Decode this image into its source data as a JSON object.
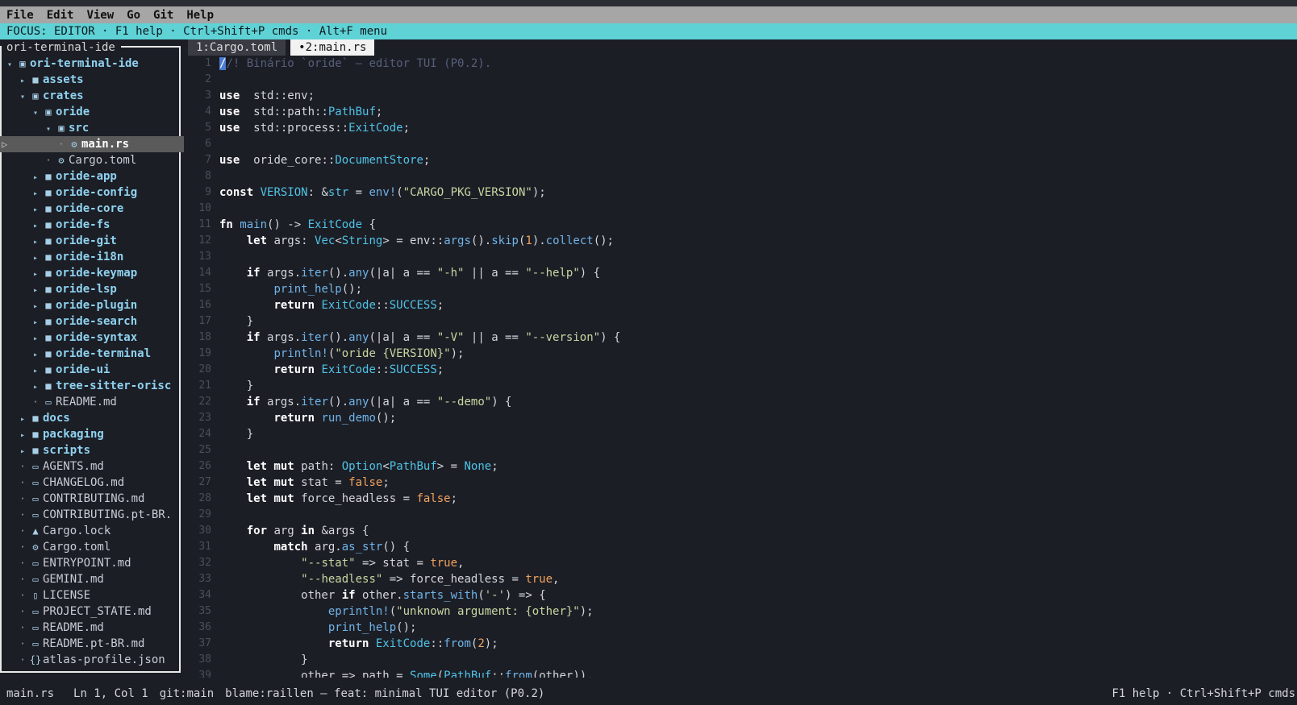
{
  "menu": [
    "File",
    "Edit",
    "View",
    "Go",
    "Git",
    "Help"
  ],
  "focus_bar": "FOCUS: EDITOR  ·  F1 help · Ctrl+Shift+P cmds · Alt+F menu",
  "sidebar": {
    "title": "ori-terminal-ide",
    "items": [
      {
        "label": "ori-terminal-ide",
        "kind": "dir",
        "depth": 1,
        "expanded": true,
        "icon": "folder-open-icon"
      },
      {
        "label": "assets",
        "kind": "dir",
        "depth": 2,
        "expanded": false,
        "icon": "folder-icon"
      },
      {
        "label": "crates",
        "kind": "dir",
        "depth": 2,
        "expanded": true,
        "icon": "folder-open-icon"
      },
      {
        "label": "oride",
        "kind": "dir",
        "depth": 3,
        "expanded": true,
        "icon": "folder-open-icon"
      },
      {
        "label": "src",
        "kind": "dir",
        "depth": 4,
        "expanded": true,
        "icon": "folder-open-icon"
      },
      {
        "label": "main.rs",
        "kind": "file",
        "depth": 5,
        "selected": true,
        "icon": "rust-icon"
      },
      {
        "label": "Cargo.toml",
        "kind": "file",
        "depth": 4,
        "icon": "gear-icon"
      },
      {
        "label": "oride-app",
        "kind": "dir",
        "depth": 3,
        "expanded": false,
        "icon": "folder-icon"
      },
      {
        "label": "oride-config",
        "kind": "dir",
        "depth": 3,
        "expanded": false,
        "icon": "folder-icon"
      },
      {
        "label": "oride-core",
        "kind": "dir",
        "depth": 3,
        "expanded": false,
        "icon": "folder-icon"
      },
      {
        "label": "oride-fs",
        "kind": "dir",
        "depth": 3,
        "expanded": false,
        "icon": "folder-icon"
      },
      {
        "label": "oride-git",
        "kind": "dir",
        "depth": 3,
        "expanded": false,
        "icon": "folder-icon"
      },
      {
        "label": "oride-i18n",
        "kind": "dir",
        "depth": 3,
        "expanded": false,
        "icon": "folder-icon"
      },
      {
        "label": "oride-keymap",
        "kind": "dir",
        "depth": 3,
        "expanded": false,
        "icon": "folder-icon"
      },
      {
        "label": "oride-lsp",
        "kind": "dir",
        "depth": 3,
        "expanded": false,
        "icon": "folder-icon"
      },
      {
        "label": "oride-plugin",
        "kind": "dir",
        "depth": 3,
        "expanded": false,
        "icon": "folder-icon"
      },
      {
        "label": "oride-search",
        "kind": "dir",
        "depth": 3,
        "expanded": false,
        "icon": "folder-icon"
      },
      {
        "label": "oride-syntax",
        "kind": "dir",
        "depth": 3,
        "expanded": false,
        "icon": "folder-icon"
      },
      {
        "label": "oride-terminal",
        "kind": "dir",
        "depth": 3,
        "expanded": false,
        "icon": "folder-icon"
      },
      {
        "label": "oride-ui",
        "kind": "dir",
        "depth": 3,
        "expanded": false,
        "icon": "folder-icon"
      },
      {
        "label": "tree-sitter-orisc",
        "kind": "dir",
        "depth": 3,
        "expanded": false,
        "icon": "folder-icon"
      },
      {
        "label": "README.md",
        "kind": "file",
        "depth": 3,
        "icon": "markdown-icon"
      },
      {
        "label": "docs",
        "kind": "dir",
        "depth": 2,
        "expanded": false,
        "icon": "folder-icon"
      },
      {
        "label": "packaging",
        "kind": "dir",
        "depth": 2,
        "expanded": false,
        "icon": "folder-icon"
      },
      {
        "label": "scripts",
        "kind": "dir",
        "depth": 2,
        "expanded": false,
        "icon": "folder-icon"
      },
      {
        "label": "AGENTS.md",
        "kind": "file",
        "depth": 2,
        "icon": "markdown-icon"
      },
      {
        "label": "CHANGELOG.md",
        "kind": "file",
        "depth": 2,
        "icon": "markdown-icon"
      },
      {
        "label": "CONTRIBUTING.md",
        "kind": "file",
        "depth": 2,
        "icon": "markdown-icon"
      },
      {
        "label": "CONTRIBUTING.pt-BR.",
        "kind": "file",
        "depth": 2,
        "icon": "markdown-icon"
      },
      {
        "label": "Cargo.lock",
        "kind": "file",
        "depth": 2,
        "icon": "lock-icon"
      },
      {
        "label": "Cargo.toml",
        "kind": "file",
        "depth": 2,
        "icon": "gear-icon"
      },
      {
        "label": "ENTRYPOINT.md",
        "kind": "file",
        "depth": 2,
        "icon": "markdown-icon"
      },
      {
        "label": "GEMINI.md",
        "kind": "file",
        "depth": 2,
        "icon": "markdown-icon"
      },
      {
        "label": "LICENSE",
        "kind": "file",
        "depth": 2,
        "icon": "license-icon"
      },
      {
        "label": "PROJECT_STATE.md",
        "kind": "file",
        "depth": 2,
        "icon": "markdown-icon"
      },
      {
        "label": "README.md",
        "kind": "file",
        "depth": 2,
        "icon": "markdown-icon"
      },
      {
        "label": "README.pt-BR.md",
        "kind": "file",
        "depth": 2,
        "icon": "markdown-icon"
      },
      {
        "label": "atlas-profile.json",
        "kind": "file",
        "depth": 2,
        "icon": "json-icon"
      }
    ]
  },
  "tabs": [
    {
      "label": "1:Cargo.toml",
      "active": false
    },
    {
      "label": "•2:main.rs",
      "active": true
    }
  ],
  "editor": {
    "lines": [
      [
        [
          "c",
          "//! Binário `oride` — editor TUI (P0.2)."
        ]
      ],
      [],
      [
        [
          "k",
          "use"
        ],
        [
          "",
          "  std::env;"
        ]
      ],
      [
        [
          "k",
          "use"
        ],
        [
          "",
          "  std::path::"
        ],
        [
          "t",
          "PathBuf"
        ],
        [
          "",
          ";"
        ]
      ],
      [
        [
          "k",
          "use"
        ],
        [
          "",
          "  std::process::"
        ],
        [
          "t",
          "ExitCode"
        ],
        [
          "",
          ";"
        ]
      ],
      [],
      [
        [
          "k",
          "use"
        ],
        [
          "",
          "  oride_core::"
        ],
        [
          "t",
          "DocumentStore"
        ],
        [
          "",
          ";"
        ]
      ],
      [],
      [
        [
          "k",
          "const"
        ],
        [
          "",
          " "
        ],
        [
          "t",
          "VERSION"
        ],
        [
          "",
          ": &"
        ],
        [
          "t",
          "str"
        ],
        [
          "",
          " = "
        ],
        [
          "f",
          "env!"
        ],
        [
          "",
          "("
        ],
        [
          "s",
          "\"CARGO_PKG_VERSION\""
        ],
        [
          "",
          ");"
        ]
      ],
      [],
      [
        [
          "k",
          "fn"
        ],
        [
          "",
          " "
        ],
        [
          "f",
          "main"
        ],
        [
          "",
          "() -> "
        ],
        [
          "t",
          "ExitCode"
        ],
        [
          "",
          " {"
        ]
      ],
      [
        [
          "",
          "    "
        ],
        [
          "k",
          "let"
        ],
        [
          "",
          " args: "
        ],
        [
          "t",
          "Vec"
        ],
        [
          "",
          "<"
        ],
        [
          "t",
          "String"
        ],
        [
          "",
          "> = env::"
        ],
        [
          "f",
          "args"
        ],
        [
          "",
          "()."
        ],
        [
          "f",
          "skip"
        ],
        [
          "",
          "("
        ],
        [
          "n",
          "1"
        ],
        [
          "",
          ")."
        ],
        [
          "f",
          "collect"
        ],
        [
          "",
          "();"
        ]
      ],
      [],
      [
        [
          "",
          "    "
        ],
        [
          "k",
          "if"
        ],
        [
          "",
          " args."
        ],
        [
          "f",
          "iter"
        ],
        [
          "",
          "()."
        ],
        [
          "f",
          "any"
        ],
        [
          "",
          "(|a| a == "
        ],
        [
          "s",
          "\"-h\""
        ],
        [
          "",
          " || a == "
        ],
        [
          "s",
          "\"--help\""
        ],
        [
          "",
          ") {"
        ]
      ],
      [
        [
          "",
          "        "
        ],
        [
          "f",
          "print_help"
        ],
        [
          "",
          "();"
        ]
      ],
      [
        [
          "",
          "        "
        ],
        [
          "k",
          "return"
        ],
        [
          "",
          " "
        ],
        [
          "t",
          "ExitCode"
        ],
        [
          "",
          "::"
        ],
        [
          "t",
          "SUCCESS"
        ],
        [
          "",
          ";"
        ]
      ],
      [
        [
          "",
          "    }"
        ]
      ],
      [
        [
          "",
          "    "
        ],
        [
          "k",
          "if"
        ],
        [
          "",
          " args."
        ],
        [
          "f",
          "iter"
        ],
        [
          "",
          "()."
        ],
        [
          "f",
          "any"
        ],
        [
          "",
          "(|a| a == "
        ],
        [
          "s",
          "\"-V\""
        ],
        [
          "",
          " || a == "
        ],
        [
          "s",
          "\"--version\""
        ],
        [
          "",
          ") {"
        ]
      ],
      [
        [
          "",
          "        "
        ],
        [
          "f",
          "println!"
        ],
        [
          "",
          "("
        ],
        [
          "s",
          "\"oride {VERSION}\""
        ],
        [
          "",
          ");"
        ]
      ],
      [
        [
          "",
          "        "
        ],
        [
          "k",
          "return"
        ],
        [
          "",
          " "
        ],
        [
          "t",
          "ExitCode"
        ],
        [
          "",
          "::"
        ],
        [
          "t",
          "SUCCESS"
        ],
        [
          "",
          ";"
        ]
      ],
      [
        [
          "",
          "    }"
        ]
      ],
      [
        [
          "",
          "    "
        ],
        [
          "k",
          "if"
        ],
        [
          "",
          " args."
        ],
        [
          "f",
          "iter"
        ],
        [
          "",
          "()."
        ],
        [
          "f",
          "any"
        ],
        [
          "",
          "(|a| a == "
        ],
        [
          "s",
          "\"--demo\""
        ],
        [
          "",
          ") {"
        ]
      ],
      [
        [
          "",
          "        "
        ],
        [
          "k",
          "return"
        ],
        [
          "",
          " "
        ],
        [
          "f",
          "run_demo"
        ],
        [
          "",
          "();"
        ]
      ],
      [
        [
          "",
          "    }"
        ]
      ],
      [],
      [
        [
          "",
          "    "
        ],
        [
          "k",
          "let mut"
        ],
        [
          "",
          " path: "
        ],
        [
          "t",
          "Option"
        ],
        [
          "",
          "<"
        ],
        [
          "t",
          "PathBuf"
        ],
        [
          "",
          "> = "
        ],
        [
          "t",
          "None"
        ],
        [
          "",
          ";"
        ]
      ],
      [
        [
          "",
          "    "
        ],
        [
          "k",
          "let mut"
        ],
        [
          "",
          " stat = "
        ],
        [
          "n",
          "false"
        ],
        [
          "",
          ";"
        ]
      ],
      [
        [
          "",
          "    "
        ],
        [
          "k",
          "let mut"
        ],
        [
          "",
          " force_headless = "
        ],
        [
          "n",
          "false"
        ],
        [
          "",
          ";"
        ]
      ],
      [],
      [
        [
          "",
          "    "
        ],
        [
          "k",
          "for"
        ],
        [
          "",
          " arg "
        ],
        [
          "k",
          "in"
        ],
        [
          "",
          " &args {"
        ]
      ],
      [
        [
          "",
          "        "
        ],
        [
          "k",
          "match"
        ],
        [
          "",
          " arg."
        ],
        [
          "f",
          "as_str"
        ],
        [
          "",
          "() {"
        ]
      ],
      [
        [
          "",
          "            "
        ],
        [
          "s",
          "\"--stat\""
        ],
        [
          "",
          " => stat = "
        ],
        [
          "n",
          "true"
        ],
        [
          "",
          ","
        ]
      ],
      [
        [
          "",
          "            "
        ],
        [
          "s",
          "\"--headless\""
        ],
        [
          "",
          " => force_headless = "
        ],
        [
          "n",
          "true"
        ],
        [
          "",
          ","
        ]
      ],
      [
        [
          "",
          "            other "
        ],
        [
          "k",
          "if"
        ],
        [
          "",
          " other."
        ],
        [
          "f",
          "starts_with"
        ],
        [
          "",
          "("
        ],
        [
          "s",
          "'-'"
        ],
        [
          "",
          ") => {"
        ]
      ],
      [
        [
          "",
          "                "
        ],
        [
          "f",
          "eprintln!"
        ],
        [
          "",
          "("
        ],
        [
          "s",
          "\"unknown argument: {other}\""
        ],
        [
          "",
          ");"
        ]
      ],
      [
        [
          "",
          "                "
        ],
        [
          "f",
          "print_help"
        ],
        [
          "",
          "();"
        ]
      ],
      [
        [
          "",
          "                "
        ],
        [
          "k",
          "return"
        ],
        [
          "",
          " "
        ],
        [
          "t",
          "ExitCode"
        ],
        [
          "",
          "::"
        ],
        [
          "f",
          "from"
        ],
        [
          "",
          "("
        ],
        [
          "n",
          "2"
        ],
        [
          "",
          ");"
        ]
      ],
      [
        [
          "",
          "            }"
        ]
      ],
      [
        [
          "",
          "            other => path = "
        ],
        [
          "t",
          "Some"
        ],
        [
          "",
          "("
        ],
        [
          "t",
          "PathBuf"
        ],
        [
          "",
          "::"
        ],
        [
          "f",
          "from"
        ],
        [
          "",
          "(other)),"
        ]
      ]
    ]
  },
  "status": {
    "file": "main.rs",
    "position": "Ln 1, Col 1",
    "branch": "git:main",
    "blame": "blame:raillen — feat: minimal TUI editor (P0.2)",
    "hint": "F1 help · Ctrl+Shift+P cmds"
  }
}
